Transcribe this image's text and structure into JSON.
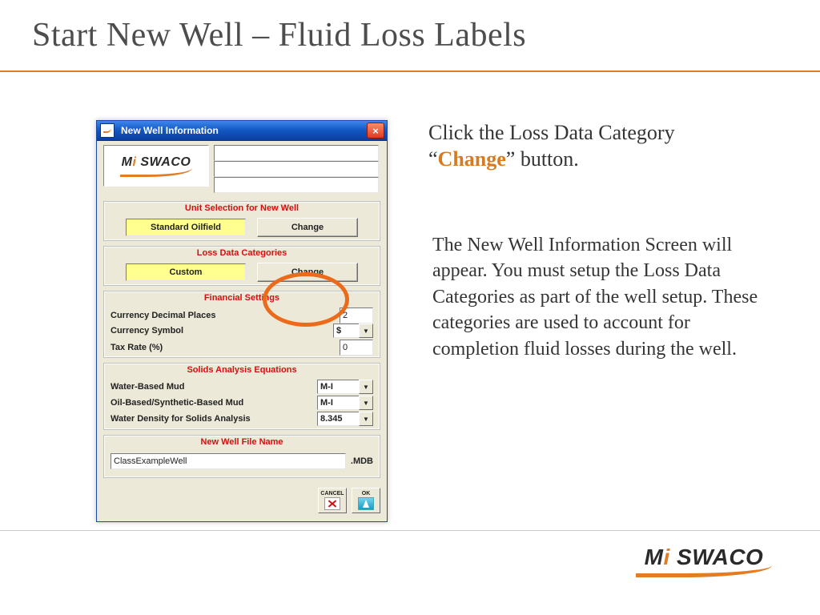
{
  "slide": {
    "title": "Start New Well – Fluid Loss Labels"
  },
  "instruction": {
    "prefix": "Click the Loss Data Category “",
    "emph": "Change",
    "suffix": "” button."
  },
  "explanation": "The New Well Information Screen will appear. You must setup the Loss Data Categories as part of the well setup. These categories are used to account for completion fluid losses during the well.",
  "branding": {
    "logo_text_prefix": "M",
    "logo_text_orange": "i",
    "logo_text_suffix": " SWACO"
  },
  "dialog": {
    "title": "New Well Information",
    "close_glyph": "×",
    "header_fields": [
      "",
      "",
      ""
    ],
    "unit_section": {
      "title": "Unit Selection for New Well",
      "value": "Standard Oilfield",
      "button": "Change"
    },
    "loss_section": {
      "title": "Loss Data Categories",
      "value": "Custom",
      "button": "Change"
    },
    "financial_section": {
      "title": "Financial Settings",
      "rows": [
        {
          "label": "Currency Decimal Places",
          "value": "2",
          "type": "text"
        },
        {
          "label": "Currency Symbol",
          "value": "$",
          "type": "combo"
        },
        {
          "label": "Tax Rate (%)",
          "value": "0",
          "type": "text"
        }
      ]
    },
    "solids_section": {
      "title": "Solids Analysis Equations",
      "rows": [
        {
          "label": "Water-Based Mud",
          "value": "M-I",
          "type": "combo"
        },
        {
          "label": "Oil-Based/Synthetic-Based Mud",
          "value": "M-I",
          "type": "combo"
        },
        {
          "label": "Water Density for Solids Analysis",
          "value": "8.345",
          "type": "combo"
        }
      ]
    },
    "file_section": {
      "title": "New Well File Name",
      "value": "ClassExampleWell",
      "ext": ".MDB"
    },
    "buttons": {
      "cancel_caption": "CANCEL",
      "ok_caption": "OK"
    }
  }
}
